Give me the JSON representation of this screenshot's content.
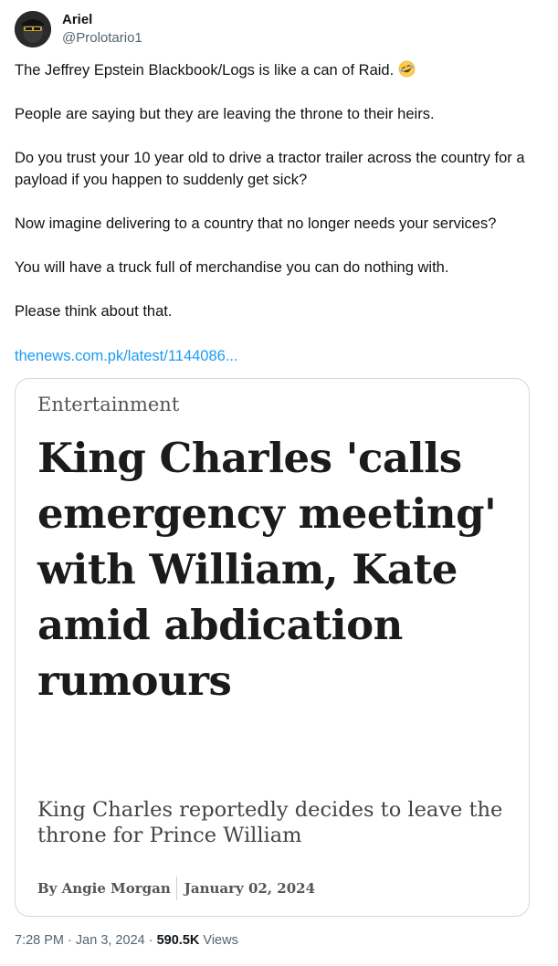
{
  "author": {
    "display_name": "Ariel",
    "handle": "@Prolotario1"
  },
  "tweet": {
    "paragraphs": [
      "The Jeffrey Epstein Blackbook/Logs is like a can of Raid.",
      "People are saying but they are leaving the throne to their  heirs.",
      "Do you trust your 10 year old to drive a tractor trailer across the country for a payload if you happen to suddenly get sick?",
      "Now imagine delivering to a country that no longer needs your services?",
      "You will have  a truck full of merchandise you can do nothing with.",
      "Please think about that."
    ],
    "emoji": "rolling-on-floor-laughing-emoji",
    "link_text": "thenews.com.pk/latest/1144086..."
  },
  "card": {
    "category": "Entertainment",
    "headline": "King Charles 'calls emergency meeting' with William, Kate amid abdication rumours",
    "subheadline": "King Charles reportedly decides to leave the throne for Prince William",
    "author": "By Angie Morgan",
    "date": "January 02, 2024"
  },
  "meta": {
    "time": "7:28 PM",
    "separator": "·",
    "date": "Jan 3, 2024",
    "views_count": "590.5K",
    "views_label": "Views"
  },
  "colors": {
    "link": "#1d9bf0",
    "secondary_text": "#536471",
    "border": "#cfd9de"
  }
}
